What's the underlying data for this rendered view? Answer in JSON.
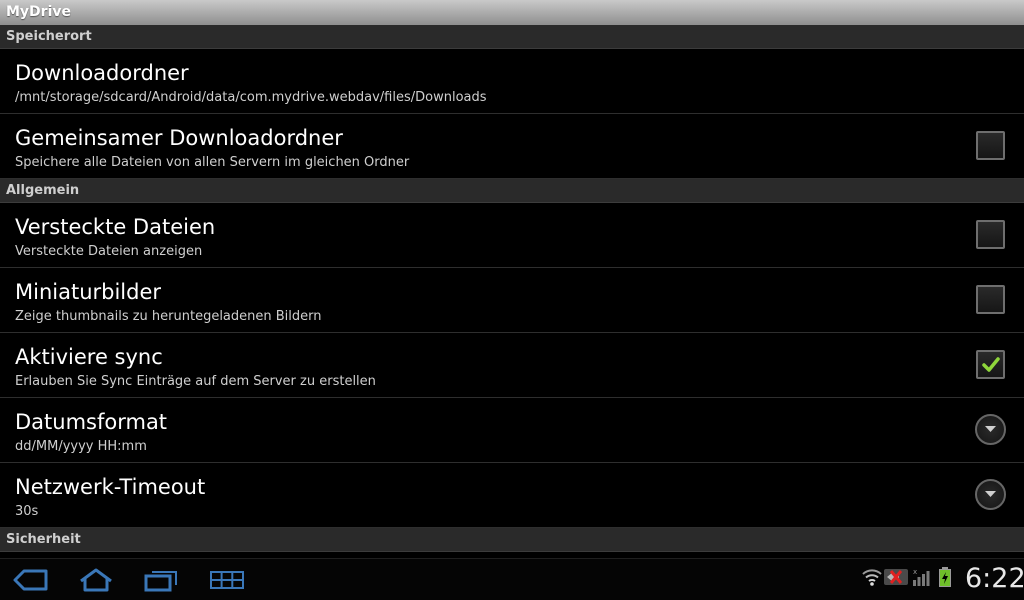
{
  "app": {
    "title": "MyDrive"
  },
  "sections": {
    "storage": "Speicherort",
    "general": "Allgemein",
    "security": "Sicherheit"
  },
  "prefs": {
    "download_folder": {
      "title": "Downloadordner",
      "summary": "/mnt/storage/sdcard/Android/data/com.mydrive.webdav/files/Downloads"
    },
    "shared_download_folder": {
      "title": "Gemeinsamer Downloadordner",
      "summary": "Speichere alle Dateien von allen Servern im gleichen Ordner",
      "checked": false
    },
    "hidden_files": {
      "title": "Versteckte Dateien",
      "summary": "Versteckte Dateien anzeigen",
      "checked": false
    },
    "thumbnails": {
      "title": "Miniaturbilder",
      "summary": "Zeige thumbnails zu heruntegeladenen Bildern",
      "checked": false
    },
    "sync": {
      "title": "Aktiviere sync",
      "summary": "Erlauben Sie Sync Einträge auf dem Server zu erstellen",
      "checked": true
    },
    "date_format": {
      "title": "Datumsformat",
      "summary": "dd/MM/yyyy HH:mm"
    },
    "network_timeout": {
      "title": "Netzwerk-Timeout",
      "summary": "30s"
    }
  },
  "statusbar": {
    "time": "6:22"
  },
  "colors": {
    "accent_check": "#8fd63b",
    "nav_icon": "#3a77b8"
  }
}
